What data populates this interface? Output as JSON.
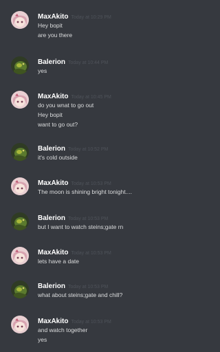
{
  "messages": [
    {
      "author": "MaxAkito",
      "avatar": "maxakito-avatar",
      "timestamp": "Today at 10:29 PM",
      "lines": [
        "Hey bopit",
        "are you there"
      ]
    },
    {
      "author": "Balerion",
      "avatar": "balerion-avatar",
      "timestamp": "Today at 10:44 PM",
      "lines": [
        "yes"
      ]
    },
    {
      "author": "MaxAkito",
      "avatar": "maxakito-avatar",
      "timestamp": "Today at 10:45 PM",
      "lines": [
        "do you wnat to go out",
        "Hey bopit",
        "want to go out?"
      ]
    },
    {
      "author": "Balerion",
      "avatar": "balerion-avatar",
      "timestamp": "Today at 10:52 PM",
      "lines": [
        "it's cold outside"
      ]
    },
    {
      "author": "MaxAkito",
      "avatar": "maxakito-avatar",
      "timestamp": "Today at 10:53 PM",
      "lines": [
        "The moon is shining bright tonight...."
      ]
    },
    {
      "author": "Balerion",
      "avatar": "balerion-avatar",
      "timestamp": "Today at 10:53 PM",
      "lines": [
        "but I want to watch steins;gate rn"
      ]
    },
    {
      "author": "MaxAkito",
      "avatar": "maxakito-avatar",
      "timestamp": "Today at 10:53 PM",
      "lines": [
        "lets have a date"
      ]
    },
    {
      "author": "Balerion",
      "avatar": "balerion-avatar",
      "timestamp": "Today at 10:53 PM",
      "lines": [
        "what about steins;gate and chill?"
      ]
    },
    {
      "author": "MaxAkito",
      "avatar": "maxakito-avatar",
      "timestamp": "Today at 10:53 PM",
      "lines": [
        "and watch together",
        "yes"
      ]
    }
  ],
  "colors": {
    "background": "#36393f",
    "author": "#ffffff",
    "text": "#dcddde",
    "timestamp": "#4f535a"
  }
}
